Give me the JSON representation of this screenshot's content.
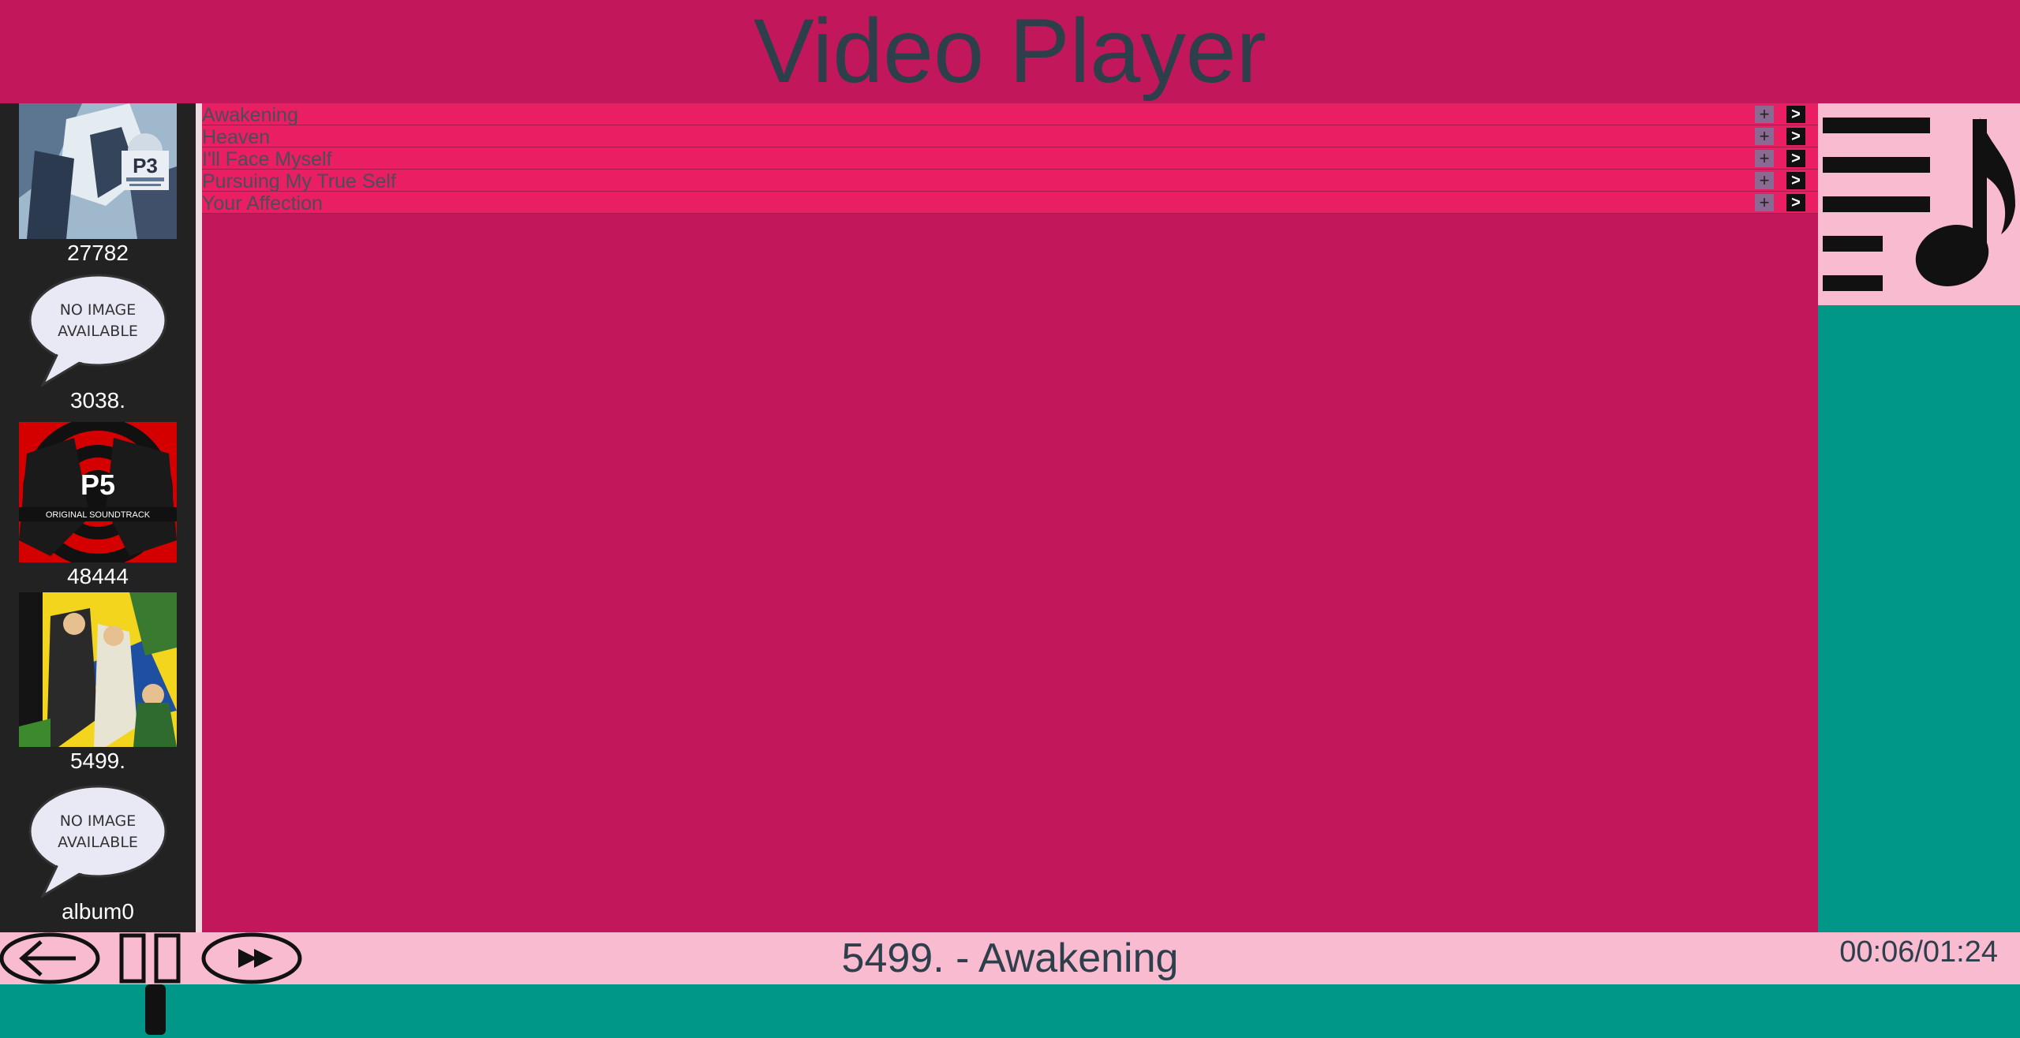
{
  "header": {
    "title": "Video Player"
  },
  "sidebar": {
    "albums": [
      {
        "name": "27782",
        "cover": "Persona 3 soundtrack cover",
        "has_image": true
      },
      {
        "name": "3038.",
        "cover": "NO IMAGE AVAILABLE",
        "has_image": false
      },
      {
        "name": "48444",
        "cover": "Persona 5 original soundtrack cover",
        "has_image": true
      },
      {
        "name": "5499.",
        "cover": "Persona 4 soundtrack cover",
        "has_image": true
      },
      {
        "name": "album0",
        "cover": "NO IMAGE AVAILABLE",
        "has_image": false
      }
    ],
    "no_image_text": {
      "line1": "NO IMAGE",
      "line2": "AVAILABLE"
    }
  },
  "tracks": [
    {
      "title": "Awakening",
      "add_label": "+",
      "play_label": ">"
    },
    {
      "title": "Heaven",
      "add_label": "+",
      "play_label": ">"
    },
    {
      "title": "I'll Face Myself",
      "add_label": "+",
      "play_label": ">"
    },
    {
      "title": "Pursuing My True Self",
      "add_label": "+",
      "play_label": ">"
    },
    {
      "title": "Your Affection",
      "add_label": "+",
      "play_label": ">"
    }
  ],
  "player": {
    "now_playing": "5499. - Awakening",
    "time": "00:06/01:24",
    "progress_fraction": 0.071
  },
  "icons": {
    "back": "back-arrow-icon",
    "pause": "pause-icon",
    "forward": "fast-forward-icon",
    "queue": "playlist-queue-icon"
  },
  "colors": {
    "header_bg": "#c2185b",
    "track_bg": "#e91e63",
    "accent_teal": "#009688",
    "pink_light": "#f8bbd0",
    "sidebar_bg": "#222222"
  }
}
